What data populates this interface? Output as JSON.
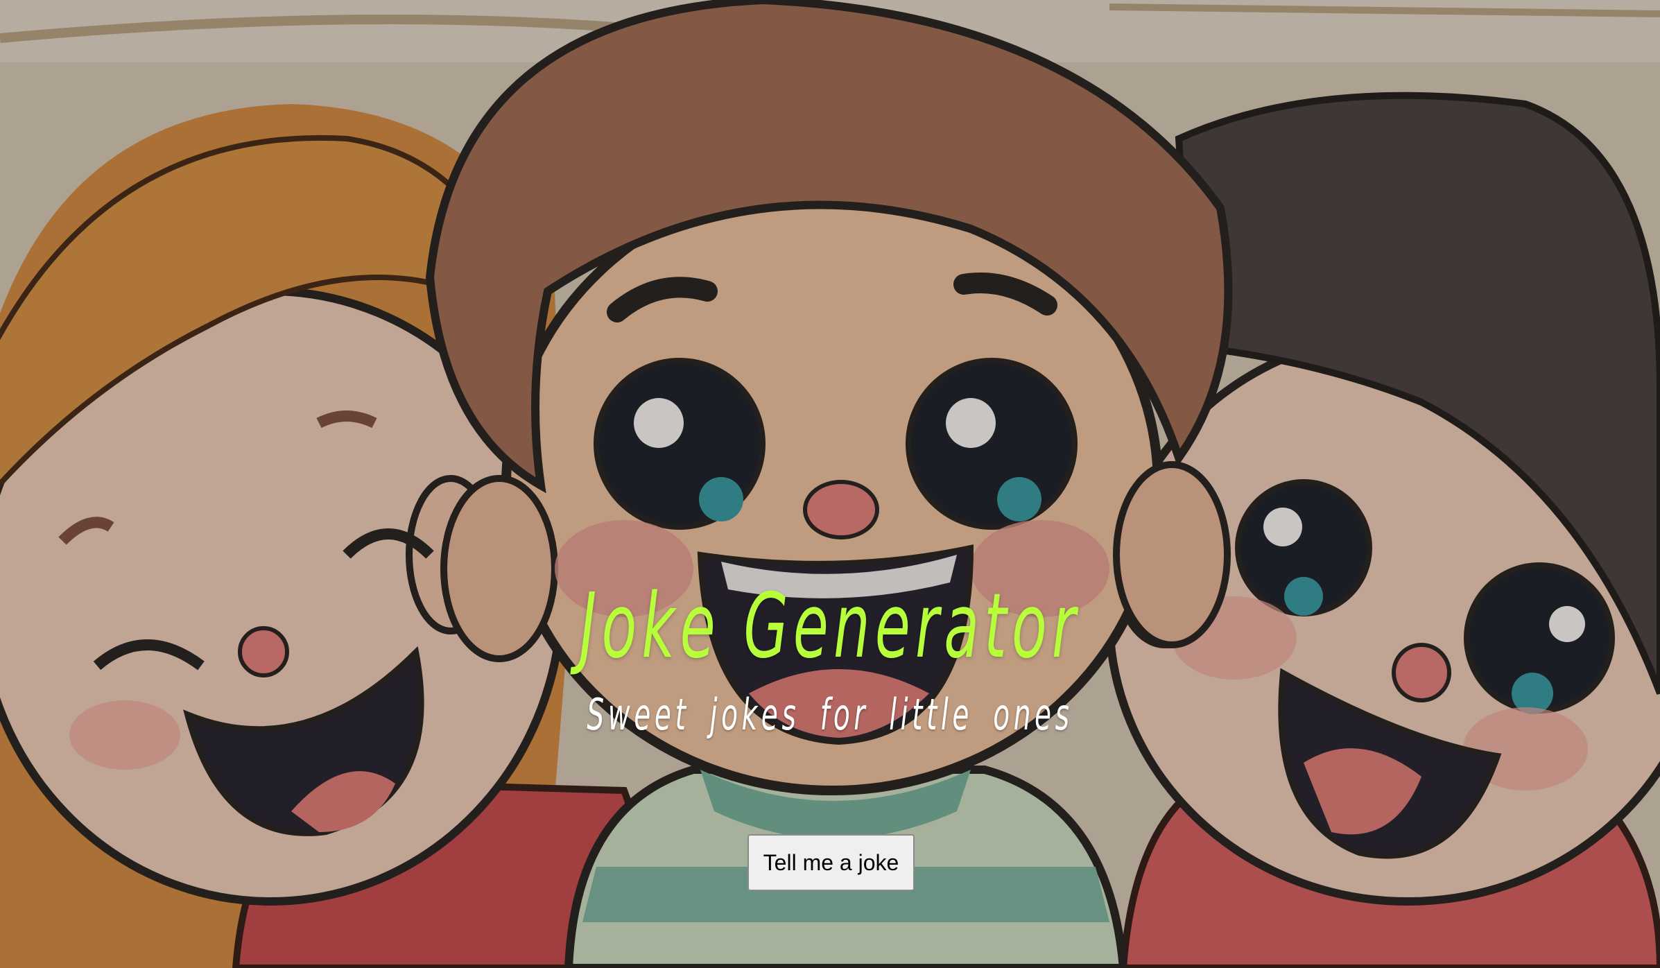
{
  "page": {
    "title": "Joke Generator",
    "subtitle": "Sweet jokes for little ones",
    "button_label": "Tell me a joke"
  },
  "colors": {
    "title": "#b6ff3a",
    "subtitle": "#ffffff",
    "button_bg": "#efefef",
    "button_text": "#000000",
    "overlay": "rgba(60,45,35,0.28)"
  },
  "background_image": {
    "depicts": "three cartoon kids laughing"
  }
}
